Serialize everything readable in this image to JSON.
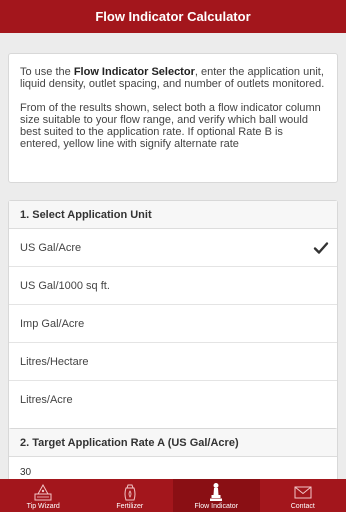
{
  "header": {
    "title": "Flow Indicator Calculator"
  },
  "intro": {
    "p1_before": "To use the ",
    "p1_bold": "Flow Indicator Selector",
    "p1_after": ", enter the application unit, liquid density, outlet spacing, and number of outlets monitored.",
    "p2": "From of the results shown, select both a flow indicator column size suitable to your flow range, and verify which ball would best suited to the application rate. If optional Rate B is entered, yellow line with signify alternate rate"
  },
  "units": {
    "heading": "1. Select Application Unit",
    "options": [
      "US Gal/Acre",
      "US Gal/1000 sq ft.",
      "Imp Gal/Acre",
      "Litres/Hectare",
      "Litres/Acre"
    ],
    "selected": "US Gal/Acre",
    "check_icon": "checkmark-icon"
  },
  "rate": {
    "heading": "2. Target Application Rate A (US Gal/Acre)",
    "value": "30"
  },
  "tabbar": {
    "tabs": [
      {
        "label": "Tip Wizard",
        "icon": "wizard-hat-icon"
      },
      {
        "label": "Fertilizer",
        "icon": "fertilizer-bag-icon"
      },
      {
        "label": "Flow Indicator",
        "icon": "flow-indicator-icon"
      },
      {
        "label": "Contact",
        "icon": "envelope-icon"
      }
    ],
    "active": "Flow Indicator"
  },
  "colors": {
    "brand": "#a3161c",
    "active_tab": "#8a0f14"
  }
}
